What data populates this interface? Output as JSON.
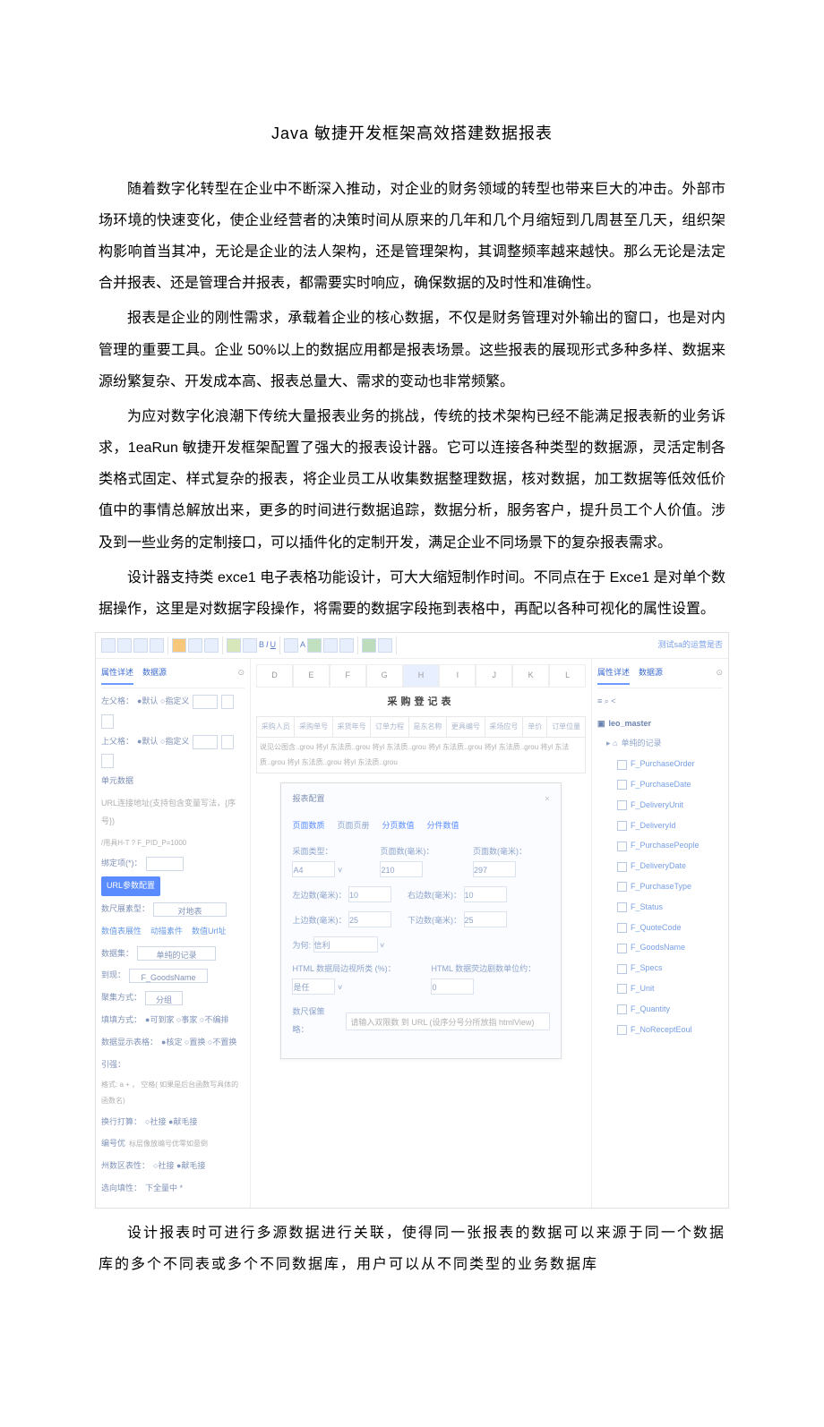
{
  "title": "Java 敏捷开发框架高效搭建数据报表",
  "paragraphs": [
    "随着数字化转型在企业中不断深入推动，对企业的财务领域的转型也带来巨大的冲击。外部市场环境的快速变化，使企业经营者的决策时间从原来的几年和几个月缩短到几周甚至几天，组织架构影响首当其冲，无论是企业的法人架构，还是管理架构，其调整频率越来越快。那么无论是法定合并报表、还是管理合并报表，都需要实时响应，确保数据的及时性和准确性。",
    "报表是企业的刚性需求，承载着企业的核心数据，不仅是财务管理对外输出的窗口，也是对内管理的重要工具。企业 50%以上的数据应用都是报表场景。这些报表的展现形式多种多样、数据来源纷繁复杂、开发成本高、报表总量大、需求的变动也非常频繁。",
    "为应对数字化浪潮下传统大量报表业务的挑战，传统的技术架构已经不能满足报表新的业务诉求，1eaRun 敏捷开发框架配置了强大的报表设计器。它可以连接各种类型的数据源，灵活定制各类格式固定、样式复杂的报表，将企业员工从收集数据整理数据，核对数据，加工数据等低效低价值中的事情总解放出来，更多的时间进行数据追踪，数据分析，服务客户，提升员工个人价值。涉及到一些业务的定制接口，可以插件化的定制开发，满足企业不同场景下的复杂报表需求。",
    "设计器支持类 exce1 电子表格功能设计，可大大缩短制作时间。不同点在于 Exce1 是对单个数据操作，这里是对数据字段操作，将需要的数据字段拖到表格中，再配以各种可视化的属性设置。"
  ],
  "paragraph_after": "设计报表时可进行多源数据进行关联，使得同一张报表的数据可以来源于同一个数据库的多个不同表或多个不同数据库，用户可以从不同类型的业务数据库",
  "screenshot": {
    "toolbar_right": "测试sa的运营是否",
    "left_tabs": [
      "属性详述",
      "数据源"
    ],
    "left_fields": {
      "fsk_label": "左父格：",
      "fsk_opt": "●默认  ○指定义",
      "sfk_label": "上父格：",
      "sfk_opt": "●默认  ○指定义",
      "section_data": "单元数据",
      "url_param_hint": "URL连接地址(支持包含变量写法，{序号})",
      "url_example": "/用具H-T ? F_PID_P=1000",
      "bind_label": "绑定项(*)：",
      "bind_btn": "URL参数配置",
      "data_show_type": "数尺展素型：",
      "data_show_type_val": "对地表",
      "link1": "数值表展性",
      "link2": "动描素件",
      "link3": "数值Url址",
      "ds_label": "数据集：",
      "ds_val": "单纯的记录",
      "field_label": "到现：",
      "field_val": "F_GoodsName",
      "agg_label": "聚集方式：",
      "agg_val": "分组",
      "expand_label": "填填方式：",
      "expand_opt": "●可到家  ○事家  ○不编排",
      "data_show_label": "数据显示表格：",
      "data_show_opt": "●核定  ○置换  ○不置换",
      "eg_label": "引强：",
      "eg_val": "格式: a + ， 空格( 如果是后台函数写具体的函数名)",
      "line_label": "换行打算：",
      "line_opt": "○社接  ●献毛接",
      "line_no_label": "编号优",
      "line_no_hint": "标层像放编号优零如意倒",
      "col_hidden_label": "州数区表性：",
      "col_hidden_opt": "○社接  ●献毛接",
      "clickarea_label": "选向填性：",
      "clickarea_val": "下全量中 *"
    },
    "columns": [
      "D",
      "E",
      "F",
      "G",
      "H",
      "I",
      "J",
      "K",
      "L"
    ],
    "sheet_title": "采购登记表",
    "table_headers": [
      "采购人员",
      "采购单号",
      "采货年号",
      "订单力程",
      "是东名称",
      "更具编号",
      "采场应号",
      "单价",
      "订单位量"
    ],
    "table_row": "说见公图含..grou  将yl 东法质..grou  将yl 东法质..grou  将yl 东法质..grou  将yl 东法质..grou  将yl 东法质..grou  将yl 东法质..grou  将yl 东法质..grou",
    "dialog": {
      "title": "报表配置",
      "tabs": [
        "页面数质",
        "页面页册",
        "分页数值",
        "分件数值"
      ],
      "row1": {
        "a": "采面类型：",
        "av": "A4",
        "b": "页面数(毫米)：",
        "bv": "210",
        "c": "页面数(毫米)：",
        "cv": "297"
      },
      "row2": {
        "a": "左边数(毫米)：",
        "av": "10",
        "b": "右边数(毫米)：",
        "bv": "10"
      },
      "row3": {
        "a": "上边数(毫米)：",
        "av": "25",
        "b": "下边数(毫米)：",
        "bv": "25"
      },
      "row4": {
        "a": "为何:",
        "av": "信利"
      },
      "row5": {
        "a": "HTML 数据局边视所类 (%)：",
        "av": "是任",
        "b": "HTML 数据荧边剧数单位约：",
        "bv": "0"
      },
      "row6": {
        "a": "数尺保策略：",
        "ph": "请输入双限数 到 URL (设序分号分所放指 htmlView)"
      }
    },
    "right_tabs_icons": "≡  ⌕  <",
    "tree_root": "leo_master",
    "tree_group": "单纯的记录",
    "tree_items": [
      "F_PurchaseOrder",
      "F_PurchaseDate",
      "F_DeliveryUnit",
      "F_DeliveryId",
      "F_PurchasePeople",
      "F_DeliveryDate",
      "F_PurchaseType",
      "F_Status",
      "F_QuoteCode",
      "F_GoodsName",
      "F_Specs",
      "F_Unit",
      "F_Quantity",
      "F_NoReceptEoul"
    ]
  }
}
